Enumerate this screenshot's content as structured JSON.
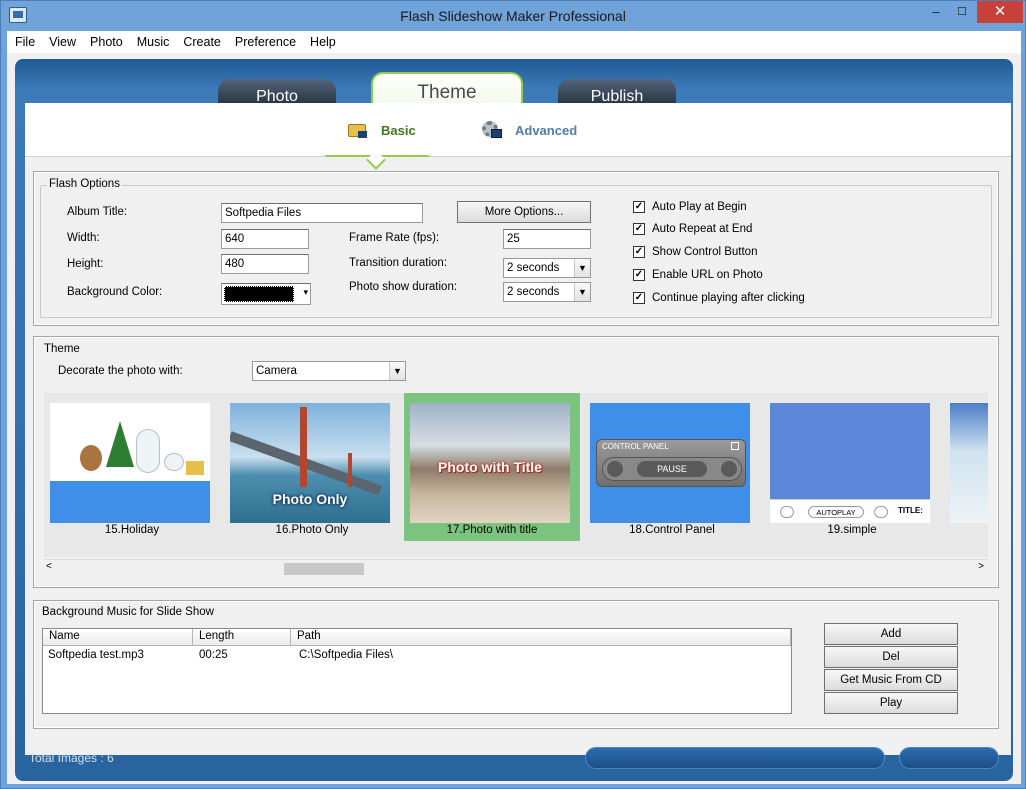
{
  "window": {
    "title": "Flash Slideshow Maker Professional",
    "min": "–",
    "max": "☐",
    "close": "✕"
  },
  "menu": [
    "File",
    "View",
    "Photo",
    "Music",
    "Create",
    "Preference",
    "Help"
  ],
  "tabs": {
    "photo": "Photo",
    "theme": "Theme",
    "publish": "Publish",
    "active": "Theme"
  },
  "subtabs": {
    "basic": "Basic",
    "advanced": "Advanced",
    "active": "Basic"
  },
  "flash_options": {
    "legend": "Flash Options",
    "album_title_label": "Album Title:",
    "album_title": "Softpedia Files",
    "width_label": "Width:",
    "width": "640",
    "height_label": "Height:",
    "height": "480",
    "bg_color_label": "Background Color:",
    "bg_color": "#000000",
    "more_options": "More Options...",
    "frame_rate_label": "Frame Rate (fps):",
    "frame_rate": "25",
    "transition_label": "Transition duration:",
    "transition": "2 seconds",
    "show_duration_label": "Photo show duration:",
    "show_duration": "2 seconds",
    "checks": [
      {
        "label": "Auto Play at Begin",
        "checked": true
      },
      {
        "label": "Auto Repeat at End",
        "checked": true
      },
      {
        "label": "Show Control Button",
        "checked": true
      },
      {
        "label": "Enable URL on Photo",
        "checked": true
      },
      {
        "label": "Continue playing after clicking",
        "checked": true
      }
    ]
  },
  "theme": {
    "legend": "Theme",
    "decorate_label": "Decorate the photo with:",
    "decorate_value": "Camera",
    "thumbs": [
      {
        "caption": "15.Holiday"
      },
      {
        "caption": "16.Photo Only",
        "overlay": "Photo Only"
      },
      {
        "caption": "17.Photo with title",
        "overlay": "Photo with Title",
        "selected": true
      },
      {
        "caption": "18.Control Panel",
        "panel_title": "CONTROL PANEL",
        "panel_button": "PAUSE"
      },
      {
        "caption": "19.simple",
        "bar_autoplay": "AUTOPLAY",
        "bar_title": "TITLE:"
      }
    ]
  },
  "music": {
    "legend": "Background Music for Slide Show",
    "columns": [
      "Name",
      "Length",
      "Path"
    ],
    "rows": [
      {
        "name": "Softpedia test.mp3",
        "length": "00:25",
        "path": "C:\\Softpedia Files\\"
      }
    ],
    "buttons": {
      "add": "Add",
      "del": "Del",
      "cd": "Get Music From CD",
      "play": "Play"
    }
  },
  "status": {
    "total_images": "Total Images : 6"
  },
  "colors": {
    "accent_green": "#8fce46",
    "frame_blue": "#2a649f",
    "selection": "#7bc47f"
  }
}
